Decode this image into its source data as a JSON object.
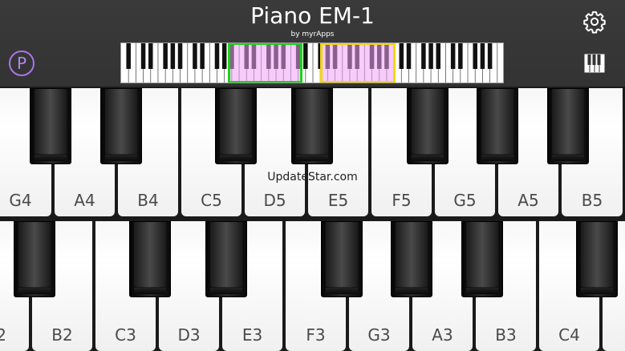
{
  "app": {
    "title": "Piano EM-1",
    "subtitle": "by myrApps",
    "p_button_label": "P",
    "watermark": "UpdateStar.com"
  },
  "icons": {
    "settings": "gear-icon",
    "keyboard_layout": "piano-keys-icon"
  },
  "colors": {
    "accent_purple": "#a974ea",
    "green_selection": "#19d419",
    "yellow_selection": "#f2d611",
    "selection_fill": "#f0a0f5"
  },
  "upper_keyboard": {
    "white_keys": [
      "G4",
      "A4",
      "B4",
      "C5",
      "D5",
      "E5",
      "F5",
      "G5",
      "A5",
      "B5"
    ]
  },
  "lower_keyboard": {
    "white_keys": [
      "2",
      "B2",
      "C3",
      "D3",
      "E3",
      "F3",
      "G3",
      "A3",
      "B3",
      "C4"
    ]
  }
}
